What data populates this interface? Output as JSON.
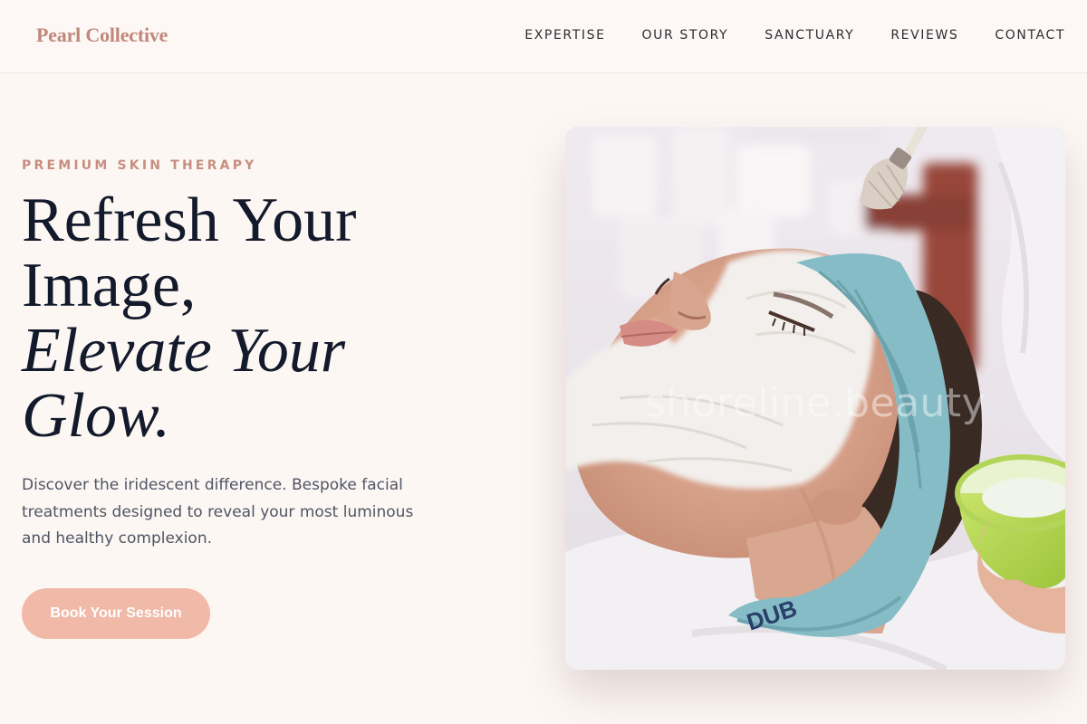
{
  "brand": {
    "name": "Pearl Collective"
  },
  "nav": {
    "items": [
      {
        "label": "EXPERTISE"
      },
      {
        "label": "OUR STORY"
      },
      {
        "label": "SANCTUARY"
      },
      {
        "label": "REVIEWS"
      },
      {
        "label": "CONTACT"
      }
    ]
  },
  "hero": {
    "eyebrow": "PREMIUM SKIN THERAPY",
    "title_line1": "Refresh Your",
    "title_line2": "Image,",
    "title_line3": "Elevate Your",
    "title_line4": "Glow.",
    "description": "Discover the iridescent difference. Bespoke facial treatments designed to reveal your most luminous and healthy complexion.",
    "cta_label": "Book Your Session",
    "image": {
      "alt": "Woman receiving a facial mask treatment",
      "watermark": "shoreline.beauty",
      "headband_text": "DUB"
    }
  },
  "colors": {
    "background": "#fdf7f4",
    "brand": "#c0877a",
    "eyebrow": "#c78e80",
    "heading": "#131a2b",
    "body_text": "#4e5563",
    "cta_bg": "#f1b9a8",
    "cta_text": "#ffffff"
  }
}
